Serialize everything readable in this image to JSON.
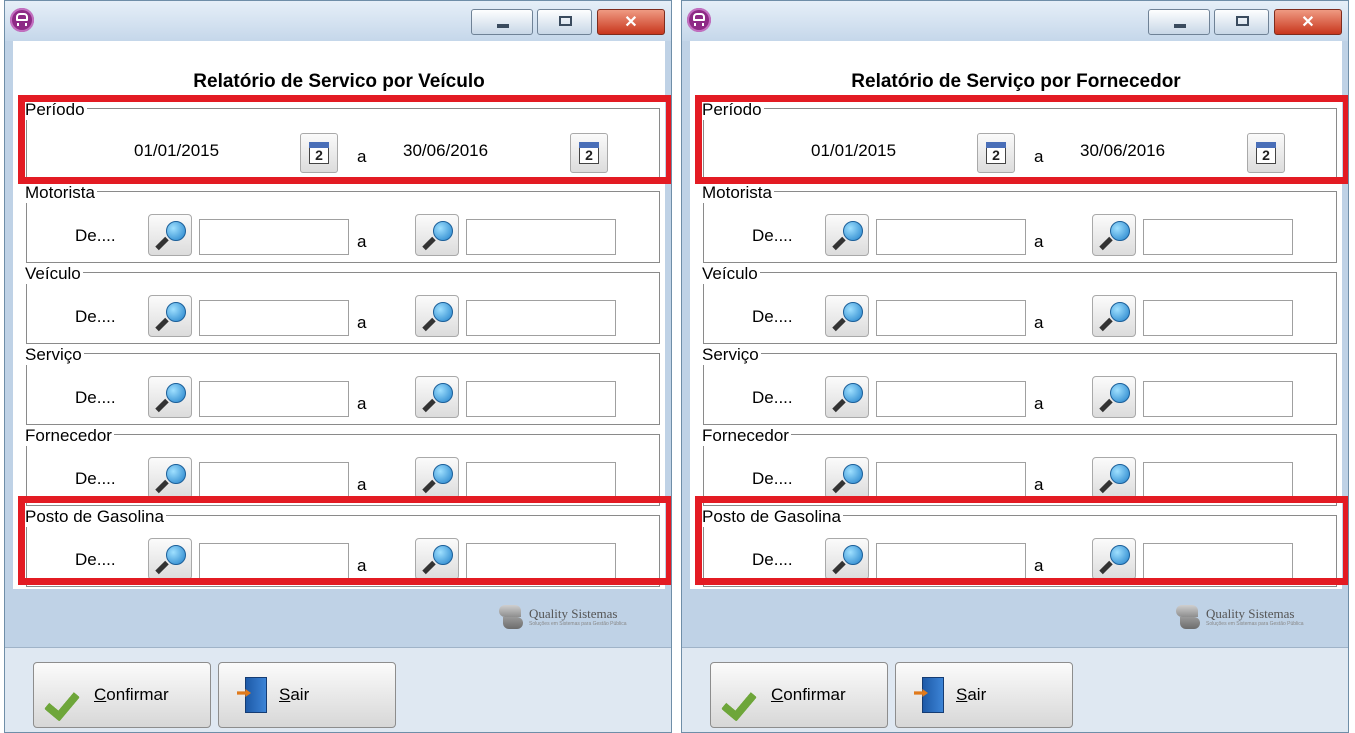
{
  "windows": [
    {
      "title": "Relatório de Servico por Veículo",
      "groups": [
        {
          "label": "Período",
          "type": "date",
          "from": "01/01/2015",
          "sep": "a",
          "to": "30/06/2016"
        },
        {
          "label": "Motorista",
          "type": "range",
          "de": "De....",
          "sep": "a"
        },
        {
          "label": "Veículo",
          "type": "range",
          "de": "De....",
          "sep": "a"
        },
        {
          "label": "Serviço",
          "type": "range",
          "de": "De....",
          "sep": "a"
        },
        {
          "label": "Fornecedor",
          "type": "range",
          "de": "De....",
          "sep": "a"
        },
        {
          "label": "Posto de Gasolina",
          "type": "range",
          "de": "De....",
          "sep": "a"
        }
      ],
      "logo": {
        "name": "Quality Sistemas",
        "tagline": "Soluções em Sistemas para Gestão Pública"
      },
      "buttons": {
        "confirm_hotkey": "C",
        "confirm_rest": "onfirmar",
        "exit_hotkey": "S",
        "exit_rest": "air"
      }
    },
    {
      "title": "Relatório de Serviço por Fornecedor",
      "groups": [
        {
          "label": "Período",
          "type": "date",
          "from": "01/01/2015",
          "sep": "a",
          "to": "30/06/2016"
        },
        {
          "label": "Motorista",
          "type": "range",
          "de": "De....",
          "sep": "a"
        },
        {
          "label": "Veículo",
          "type": "range",
          "de": "De....",
          "sep": "a"
        },
        {
          "label": "Serviço",
          "type": "range",
          "de": "De....",
          "sep": "a"
        },
        {
          "label": "Fornecedor",
          "type": "range",
          "de": "De....",
          "sep": "a"
        },
        {
          "label": "Posto de Gasolina",
          "type": "range",
          "de": "De....",
          "sep": "a"
        }
      ],
      "logo": {
        "name": "Quality Sistemas",
        "tagline": "Soluções em Sistemas para Gestão Pública"
      },
      "buttons": {
        "confirm_hotkey": "C",
        "confirm_rest": "onfirmar",
        "exit_hotkey": "S",
        "exit_rest": "air"
      }
    }
  ],
  "colors": {
    "highlight": "#e31b23",
    "window_frame": "#bfd2e6",
    "title_bar": "#dbe7f4",
    "close_button": "#c8361d"
  },
  "icons": [
    "app-bus-icon",
    "minimize-icon",
    "maximize-icon",
    "close-icon",
    "calendar-icon",
    "magnifier-icon",
    "checkmark-icon",
    "exit-door-icon",
    "quality-sistemas-logo"
  ]
}
